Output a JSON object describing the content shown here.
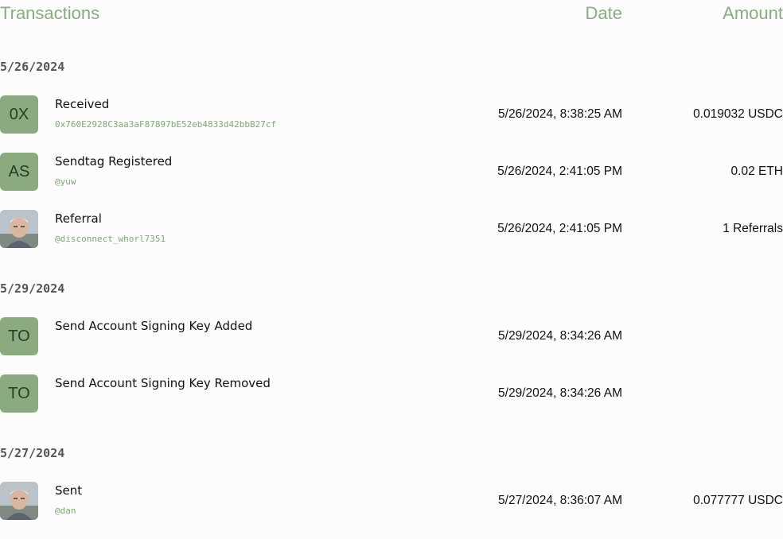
{
  "header": {
    "title": "Transactions",
    "date_col": "Date",
    "amount_col": "Amount"
  },
  "groups": [
    {
      "date": "5/26/2024",
      "items": [
        {
          "avatar_text": "0X",
          "avatar_type": "initials",
          "title": "Received",
          "subtitle": "0x760E2928C3aa3aF87897bE52eb4833d42bbB27cf",
          "datetime": "5/26/2024, 8:38:25 AM",
          "amount": "0.019032 USDC"
        },
        {
          "avatar_text": "AS",
          "avatar_type": "initials",
          "title": "Sendtag Registered",
          "subtitle": "@yuw",
          "datetime": "5/26/2024, 2:41:05 PM",
          "amount": "0.02 ETH"
        },
        {
          "avatar_text": "",
          "avatar_type": "photo",
          "title": "Referral",
          "subtitle": "@disconnect_whorl7351",
          "datetime": "5/26/2024, 2:41:05 PM",
          "amount": "1 Referrals"
        }
      ]
    },
    {
      "date": "5/29/2024",
      "items": [
        {
          "avatar_text": "TO",
          "avatar_type": "initials",
          "title": "Send Account Signing Key Added",
          "subtitle": "",
          "datetime": "5/29/2024, 8:34:26 AM",
          "amount": ""
        },
        {
          "avatar_text": "TO",
          "avatar_type": "initials",
          "title": "Send Account Signing Key Removed",
          "subtitle": "",
          "datetime": "5/29/2024, 8:34:26 AM",
          "amount": ""
        }
      ]
    },
    {
      "date": "5/27/2024",
      "items": [
        {
          "avatar_text": "",
          "avatar_type": "photo",
          "title": "Sent",
          "subtitle": "@dan",
          "datetime": "5/27/2024, 8:36:07 AM",
          "amount": "0.077777 USDC"
        }
      ]
    }
  ],
  "colors": {
    "accent": "#86ad7d",
    "avatar_bg": "#8aab7f",
    "subtitle": "#7ea874"
  }
}
